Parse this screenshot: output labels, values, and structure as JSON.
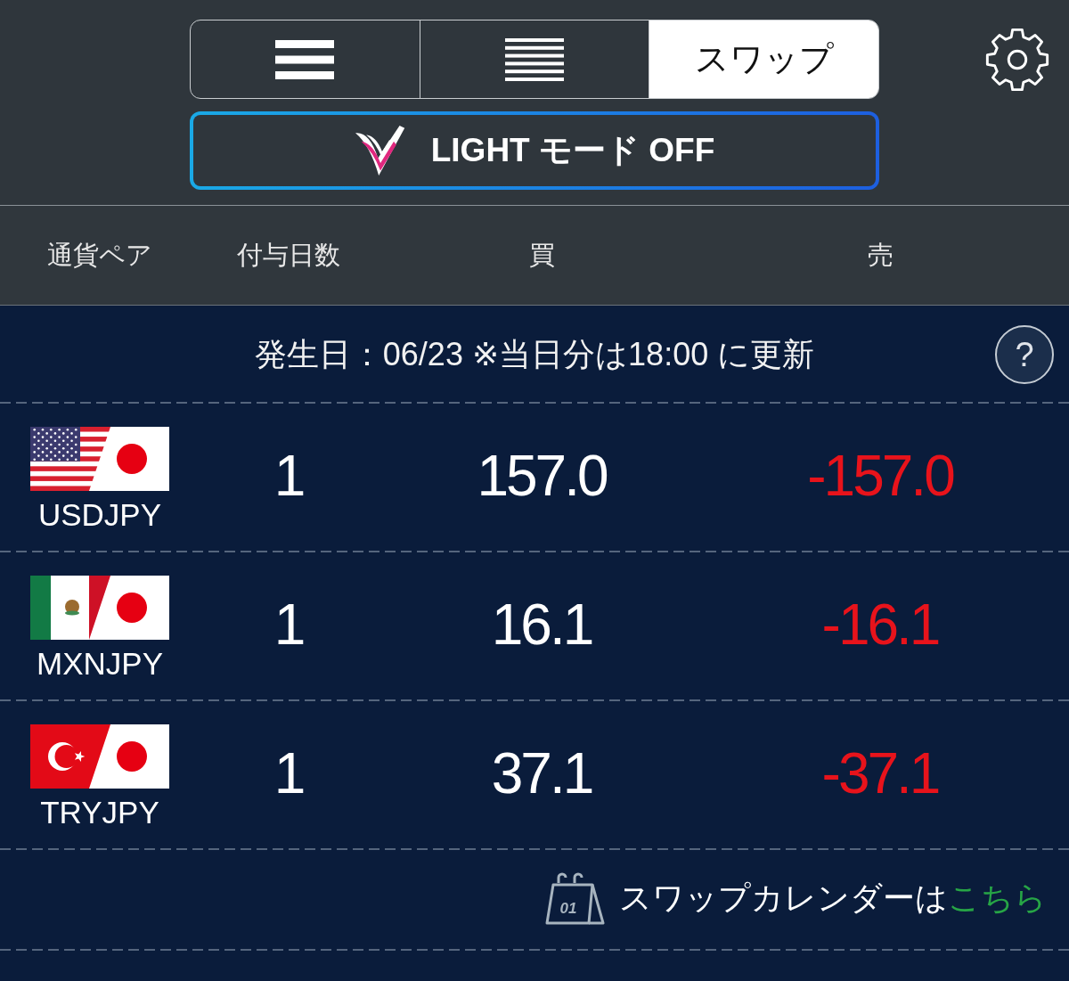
{
  "view_tabs": [
    {
      "kind": "thick-lines",
      "selected": false
    },
    {
      "kind": "thin-lines",
      "selected": false
    },
    {
      "kind": "text",
      "label": "スワップ",
      "selected": true
    }
  ],
  "light_mode_button": {
    "label": "LIGHT モード OFF"
  },
  "table": {
    "columns": [
      "通貨ペア",
      "付与日数",
      "買",
      "売"
    ],
    "notice": {
      "text": "発生日：06/23 ※当日分は18:00 に更新",
      "help_label": "?"
    },
    "rows": [
      {
        "kind": "usa",
        "pair": "USDJPY",
        "days": "1",
        "buy": "157.0",
        "sell": "-157.0"
      },
      {
        "kind": "mexico",
        "pair": "MXNJPY",
        "days": "1",
        "buy": "16.1",
        "sell": "-16.1"
      },
      {
        "kind": "turkey",
        "pair": "TRYJPY",
        "days": "1",
        "buy": "37.1",
        "sell": "-37.1"
      }
    ]
  },
  "footer": {
    "calendar_day": "01",
    "text": "スワップカレンダーは",
    "link": "こちら"
  }
}
